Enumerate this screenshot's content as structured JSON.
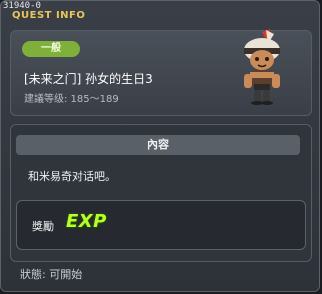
{
  "quest": {
    "id_text": "31940-0",
    "window_title": "QUEST INFO",
    "category_badge": "一般",
    "name": "[未来之门] 孙女的生日3",
    "level_text": "建議等级: 185～189",
    "content_header": "內容",
    "content_text": "和米易奇对话吧。",
    "reward_label": "獎勵",
    "reward_exp_text": "EXP",
    "status_text": "狀態:  可開始"
  },
  "colors": {
    "badge_green": "#7fb13a",
    "title_gold": "#e9c65a",
    "exp_green": "#b7ff2b"
  }
}
